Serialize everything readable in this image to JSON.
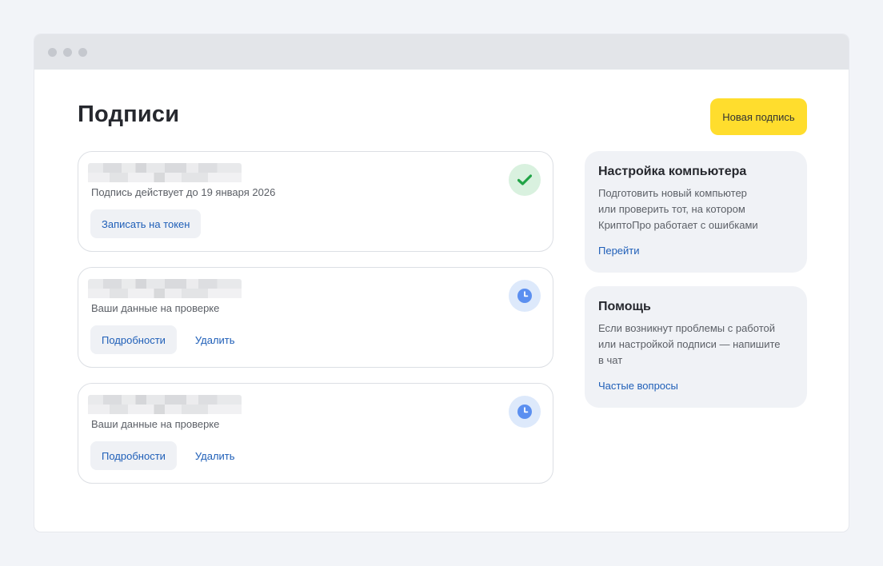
{
  "page": {
    "title": "Подписи",
    "new_button": "Новая подпись"
  },
  "signatures": [
    {
      "status": "Подпись действует до 19 января 2026",
      "state": "valid",
      "status_icon": "check-icon",
      "primary_action": "Записать на токен",
      "secondary_action": ""
    },
    {
      "status": "Ваши данные на проверке",
      "state": "pending",
      "status_icon": "clock-icon",
      "primary_action": "Подробности",
      "secondary_action": "Удалить"
    },
    {
      "status": "Ваши данные на проверке",
      "state": "pending",
      "status_icon": "clock-icon",
      "primary_action": "Подробности",
      "secondary_action": "Удалить"
    }
  ],
  "sidebar": {
    "setup": {
      "title": "Настройка компьютера",
      "text": "Подготовить новый компьютер\nили проверить тот, на котором\nКриптоПро работает с ошибками",
      "link": "Перейти"
    },
    "help": {
      "title": "Помощь",
      "text": "Если возникнут проблемы с работой\nили настройкой подписи — напишите\nв чат",
      "link": "Частые вопросы"
    }
  },
  "colors": {
    "accent": "#ffdd2d",
    "link": "#1f5fb8",
    "valid": "#22a447",
    "pending": "#5b8ff0"
  }
}
